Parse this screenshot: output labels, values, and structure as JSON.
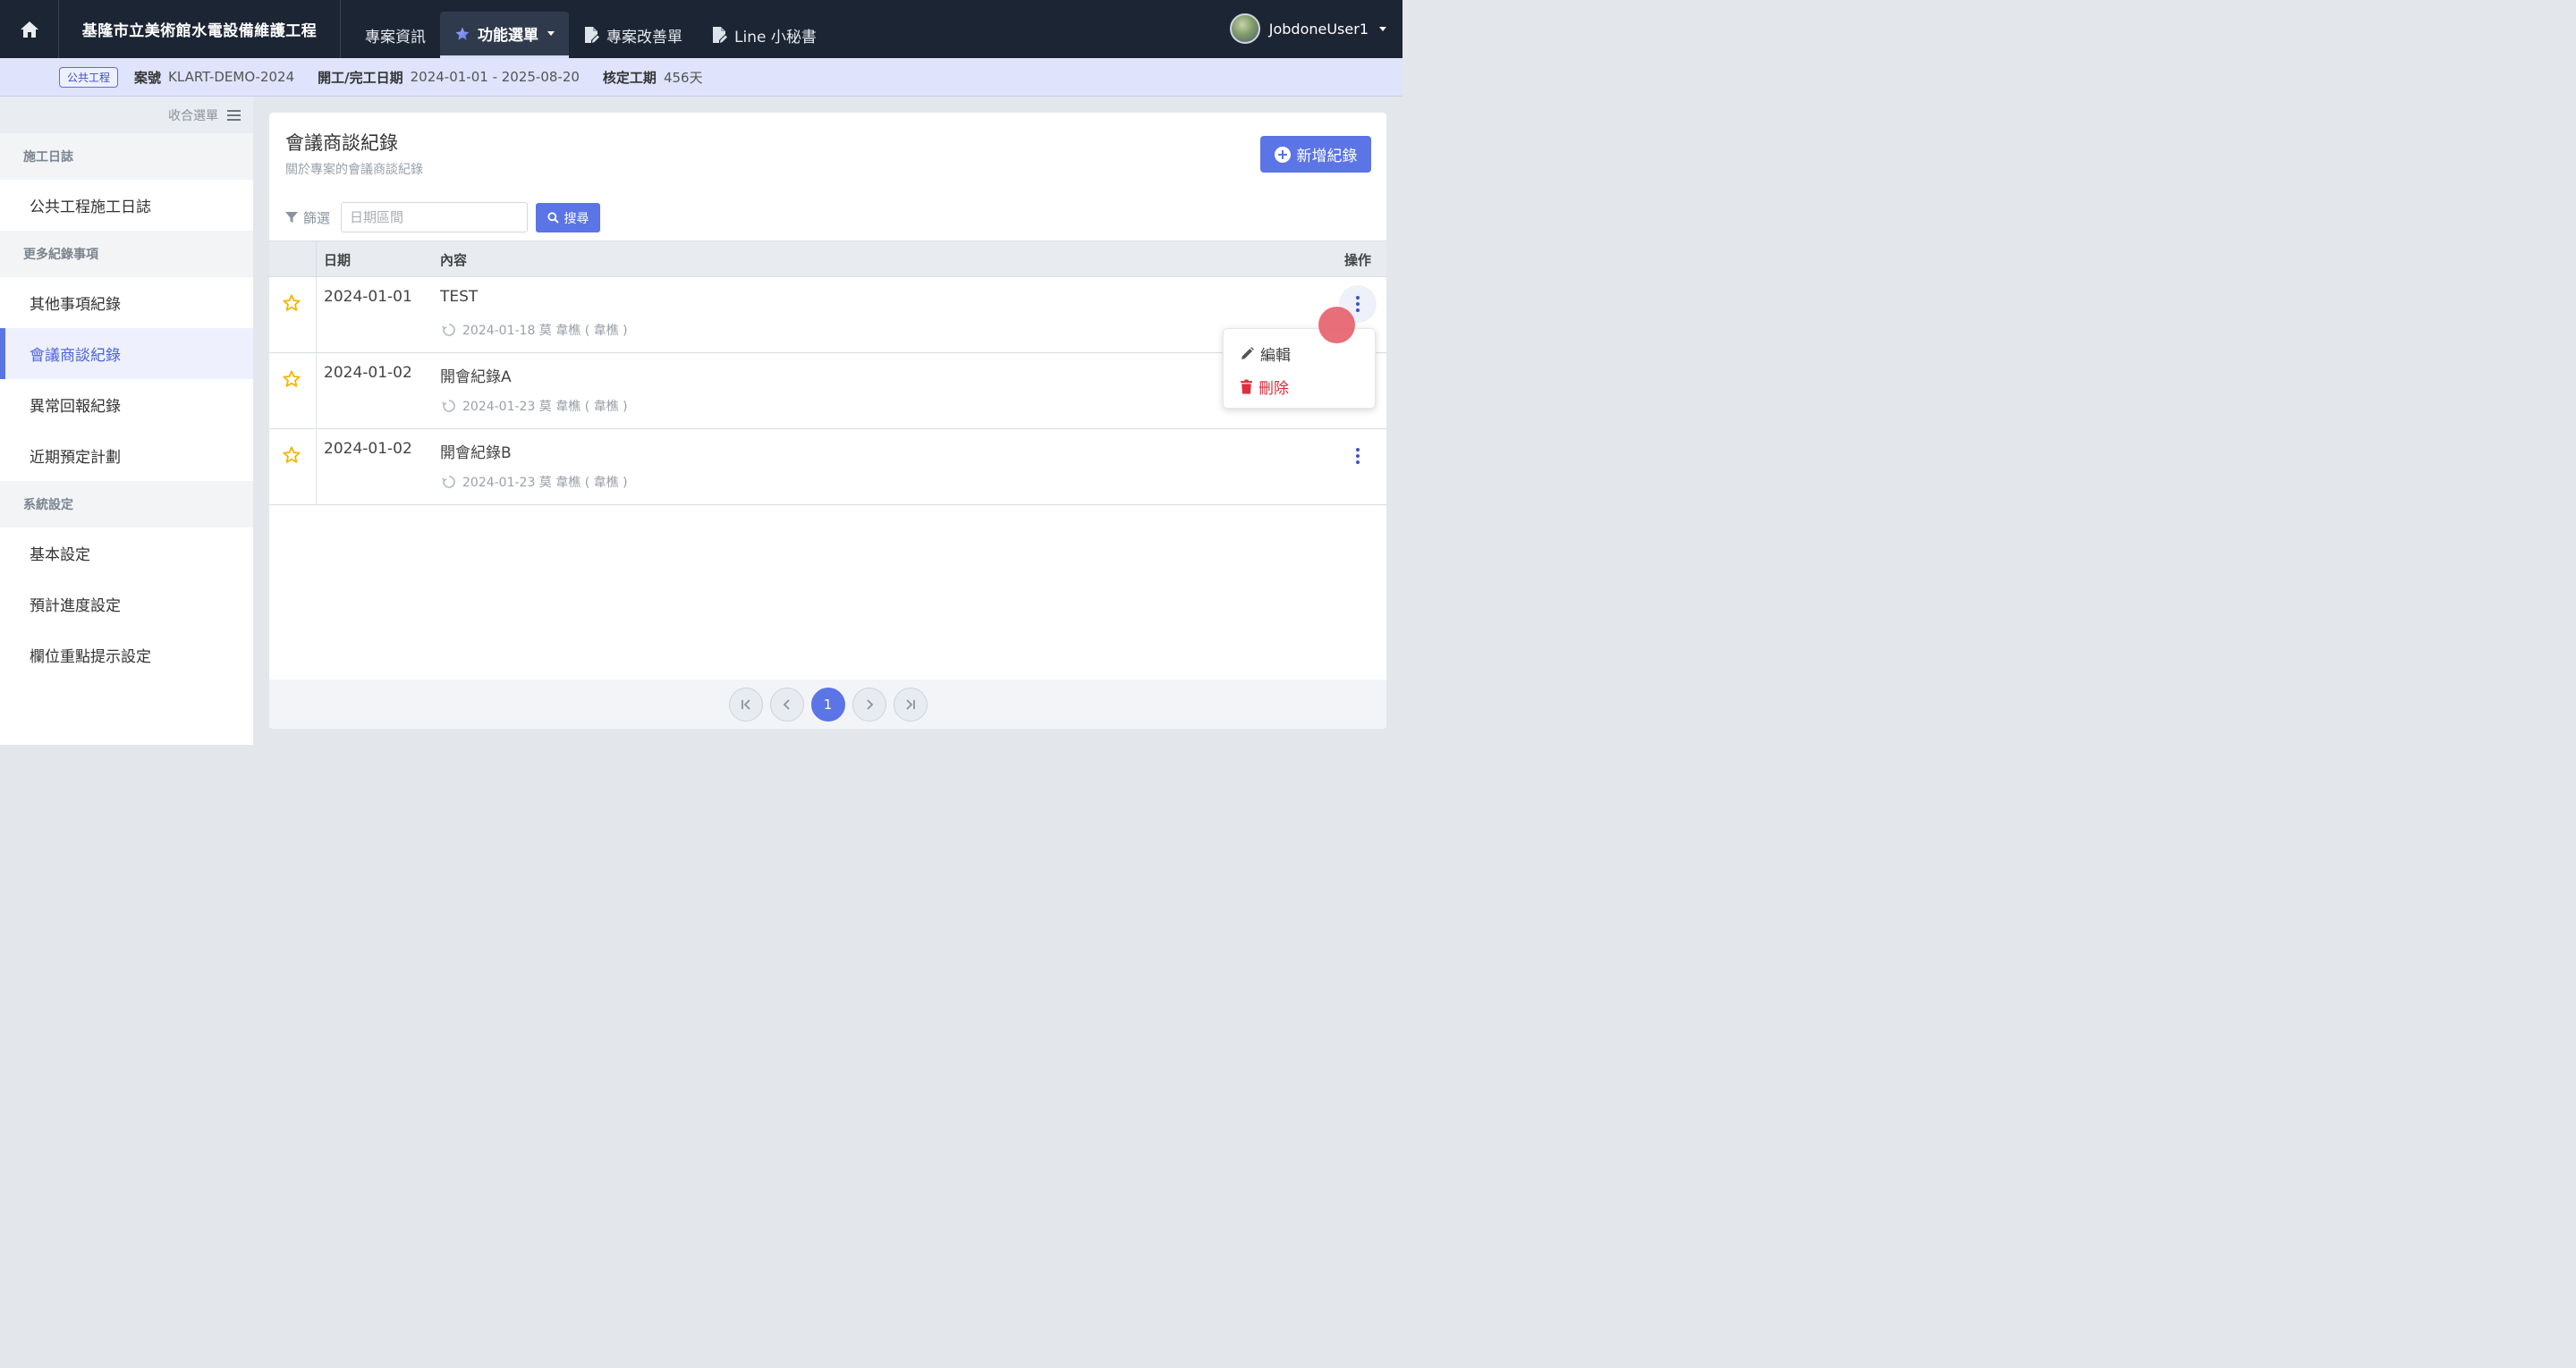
{
  "colors": {
    "nav_bg": "#1c2533",
    "accent": "#5b74e6",
    "danger": "#e02c3c",
    "star": "#f2b705",
    "info_bg": "#dfe3fb"
  },
  "topbar": {
    "home_icon": "home-icon",
    "project_title": "基隆市立美術館水電設備維護工程",
    "tabs": [
      {
        "label": "專案資訊",
        "icon": ""
      },
      {
        "label": "功能選單",
        "icon": "star-icon",
        "active": true
      },
      {
        "label": "專案改善單",
        "icon": "edit-document-icon"
      },
      {
        "label": "Line 小秘書",
        "icon": "edit-document-icon"
      }
    ],
    "user_name": "JobdoneUser1"
  },
  "infobar": {
    "badge": "公共工程",
    "case_no_label": "案號",
    "case_no": "KLART-DEMO-2024",
    "date_label": "開工/完工日期",
    "date_range": "2024-01-01 - 2025-08-20",
    "duration_label": "核定工期",
    "duration": "456天"
  },
  "sidebar": {
    "collapse_label": "收合選單",
    "sections": [
      {
        "title": "施工日誌",
        "items": [
          "公共工程施工日誌"
        ]
      },
      {
        "title": "更多紀錄事項",
        "items": [
          "其他事項紀錄",
          "會議商談紀錄",
          "異常回報紀錄",
          "近期預定計劃"
        ]
      },
      {
        "title": "系統設定",
        "items": [
          "基本設定",
          "預計進度設定",
          "欄位重點提示設定"
        ]
      }
    ],
    "active_item": "會議商談紀錄"
  },
  "main": {
    "title": "會議商談紀錄",
    "subtitle": "關於專案的會議商談紀錄",
    "add_button": "新增紀錄",
    "filter_label": "篩選",
    "date_placeholder": "日期區間",
    "search_button": "搜尋",
    "table": {
      "headers": {
        "date": "日期",
        "content": "內容",
        "actions": "操作"
      },
      "rows": [
        {
          "date": "2024-01-01",
          "content": "TEST",
          "meta": "2024-01-18 莫 韋樵 ( 韋樵 )"
        },
        {
          "date": "2024-01-02",
          "content": "開會紀錄A",
          "meta": "2024-01-23 莫 韋樵 ( 韋樵 )"
        },
        {
          "date": "2024-01-02",
          "content": "開會紀錄B",
          "meta": "2024-01-23 莫 韋樵 ( 韋樵 )"
        }
      ]
    },
    "pagination": {
      "current_page": "1"
    }
  },
  "dropdown": {
    "edit_label": "編輯",
    "delete_label": "刪除"
  }
}
